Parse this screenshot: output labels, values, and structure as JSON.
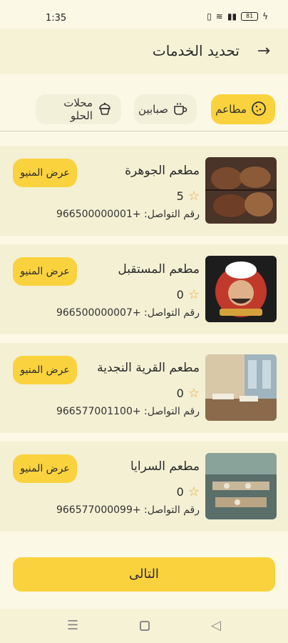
{
  "status_bar": {
    "time": "1:35",
    "battery": "81"
  },
  "header": {
    "title": "تحديد الخدمات",
    "back_icon": "arrow-right-icon"
  },
  "tabs": [
    {
      "label": "مطاعم",
      "icon": "cookie-icon",
      "active": true
    },
    {
      "label": "صبابين",
      "icon": "coffee-cup-icon",
      "active": false
    },
    {
      "label": "محلات الحلو",
      "icon": "cupcake-icon",
      "active": false
    }
  ],
  "restaurants": [
    {
      "name": "مطعم الجوهرة",
      "rating": "5",
      "phone": "رقم التواصل: +966500000001",
      "menu_label": "عرض المنيو",
      "image": "grilled-chicken-photo"
    },
    {
      "name": "مطعم المستقبل",
      "rating": "0",
      "phone": "رقم التواصل: +966500000007",
      "menu_label": "عرض المنيو",
      "image": "chef-logo"
    },
    {
      "name": "مطعم القرية النجدية",
      "rating": "0",
      "phone": "رقم التواصل: +966577001100",
      "menu_label": "عرض المنيو",
      "image": "restaurant-interior-photo"
    },
    {
      "name": "مطعم السرايا",
      "rating": "0",
      "phone": "رقم التواصل: +966577000099",
      "menu_label": "عرض المنيو",
      "image": "dining-hall-photo"
    }
  ],
  "next_button": {
    "label": "التالى"
  },
  "colors": {
    "accent": "#fad23e",
    "background": "#fbf8e6",
    "card": "#f3f0d4",
    "star": "#f2a23a"
  }
}
